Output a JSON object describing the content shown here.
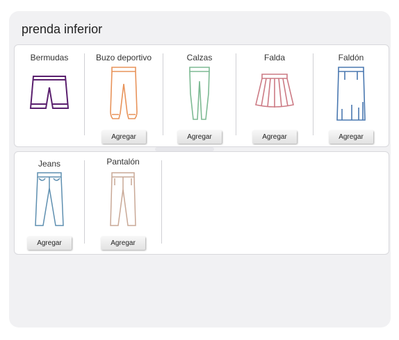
{
  "title": "prenda inferior",
  "button_label": "Agregar",
  "row1": [
    {
      "label": "Bermudas",
      "icon": "shorts-icon",
      "color": "#5a1f6e"
    },
    {
      "label": "Buzo deportivo",
      "icon": "sweatpants-icon",
      "color": "#e8935a"
    },
    {
      "label": "Calzas",
      "icon": "leggings-icon",
      "color": "#7dba93"
    },
    {
      "label": "Falda",
      "icon": "skirt-icon",
      "color": "#cc7a84"
    },
    {
      "label": "Faldón",
      "icon": "long-skirt-icon",
      "color": "#4a78b0"
    }
  ],
  "row2": [
    {
      "label": "Jeans",
      "icon": "jeans-icon",
      "color": "#5e8fb0"
    },
    {
      "label": "Pantalón",
      "icon": "trousers-icon",
      "color": "#c9a896"
    }
  ]
}
